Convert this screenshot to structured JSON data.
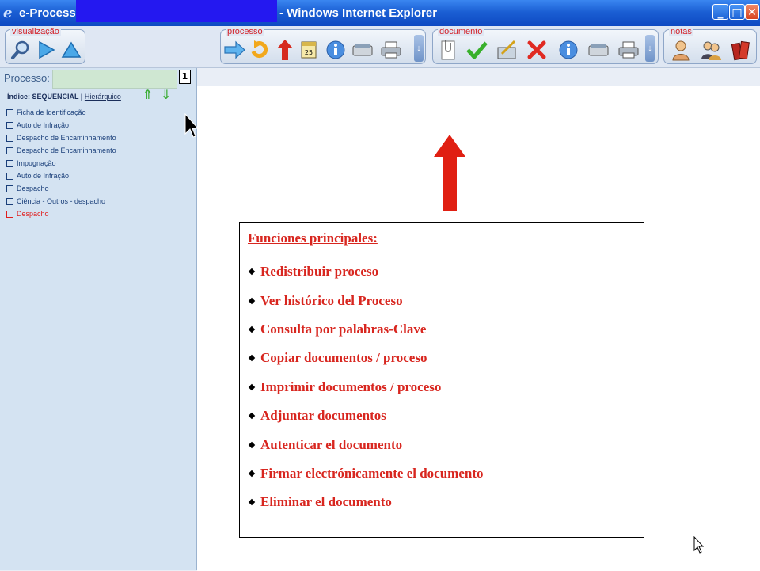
{
  "window": {
    "title": "e-Processo -",
    "title_suffix": "- Windows Internet Explorer",
    "buttons": {
      "minimize": "_",
      "maximize": "□",
      "close": "✕"
    }
  },
  "toolbar": {
    "groups": {
      "visualizacao": {
        "label": "visualização",
        "icons": [
          "magnifier-icon",
          "arrow-right-icon",
          "arrow-up-icon"
        ]
      },
      "processo": {
        "label": "processo",
        "icons": [
          "forward-arrow-icon",
          "refresh-arrow-icon",
          "red-up-arrow-icon",
          "calendar-icon",
          "info-icon",
          "scanner-icon",
          "printer-icon"
        ]
      },
      "documento": {
        "label": "documento",
        "icons": [
          "paperclip-document-icon",
          "checkmark-icon",
          "signature-icon",
          "delete-x-icon",
          "info-icon",
          "scanner-icon",
          "printer-icon"
        ]
      },
      "notas": {
        "label": "notas",
        "icons": [
          "user-icon",
          "users-icon",
          "books-icon"
        ]
      }
    },
    "calendar_day": "25"
  },
  "sidebar": {
    "process_label": "Processo:",
    "page_icon_text": "1",
    "index": {
      "prefix": "Índice: SEQUENCIAL | ",
      "link": "Hierárquico"
    },
    "items": [
      {
        "label": "Ficha de Identificação",
        "active": false
      },
      {
        "label": "Auto de Infração",
        "active": false
      },
      {
        "label": "Despacho de Encaminhamento",
        "active": false
      },
      {
        "label": "Despacho de Encaminhamento",
        "active": false
      },
      {
        "label": "Impugnação",
        "active": false
      },
      {
        "label": "Auto de Infração",
        "active": false
      },
      {
        "label": "Despacho",
        "active": false
      },
      {
        "label": "Ciência - Outros - despacho",
        "active": false
      },
      {
        "label": "Despacho",
        "active": true
      }
    ]
  },
  "callout": {
    "title": "Funciones principales:",
    "items": [
      "Redistribuir proceso",
      "Ver histórico del Proceso",
      "Consulta por palabras-Clave",
      "Copiar documentos / proceso",
      "Imprimir documentos / proceso",
      "Adjuntar documentos",
      "Autenticar el documento",
      "Firmar electrónicamente el documento",
      "Eliminar el documento"
    ]
  },
  "colors": {
    "titlebar": "#1b5fd4",
    "accent_red": "#d8261f",
    "sidebar_bg": "#d4e3f2",
    "link_blue": "#1a3f7a"
  }
}
